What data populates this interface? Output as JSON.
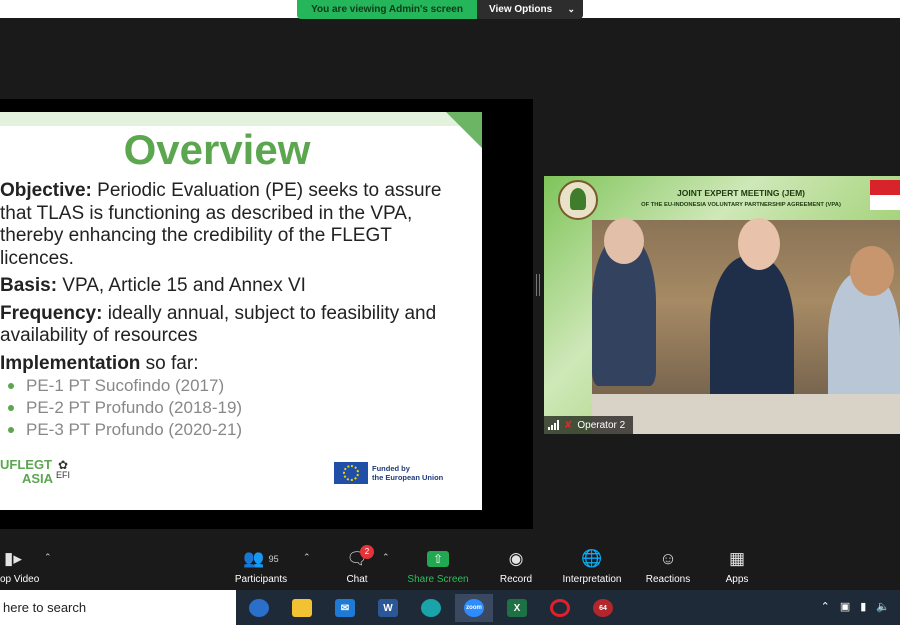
{
  "banner": {
    "viewing_text": "You are viewing Admin's screen",
    "view_options_label": "View Options"
  },
  "slide": {
    "title": "Overview",
    "objective_label": "Objective:",
    "objective_text": " Periodic Evaluation (PE) seeks to assure that TLAS  is functioning as described in the VPA, thereby enhancing the credibility of the FLEGT licences.",
    "basis_label": "Basis:",
    "basis_text": " VPA, Article 15 and Annex VI",
    "frequency_label": "Frequency:",
    "frequency_text": " ideally annual, subject to feasibility and availability of resources",
    "implementation_label": "Implementation",
    "implementation_text": " so far:",
    "bullets": [
      "PE-1 PT Sucofindo (2017)",
      "PE-2 PT Profundo (2018-19)",
      "PE-3 PT Profundo (2020-21)"
    ],
    "logo_left_line1": "UFLEGT",
    "logo_left_line2": "ASIA",
    "efi_label": "EFI",
    "eu_line1": "Funded by",
    "eu_line2": "the European Union"
  },
  "video": {
    "jem_title": "JOINT EXPERT MEETING (JEM)",
    "jem_subtitle": "OF THE EU-INDONESIA VOLUNTARY PARTNERSHIP AGREEMENT (VPA)",
    "participant_name": "Operator 2"
  },
  "toolbar": {
    "video_label": "op Video",
    "participants_label": "Participants",
    "participants_count": "95",
    "chat_label": "Chat",
    "chat_badge": "2",
    "share_label": "Share Screen",
    "record_label": "Record",
    "interpretation_label": "Interpretation",
    "reactions_label": "Reactions",
    "apps_label": "Apps"
  },
  "taskbar": {
    "search_text": "here to search",
    "chrome_badge": "64"
  },
  "colors": {
    "slide_green": "#5ba64f",
    "share_green": "#2dbd5f",
    "badge_red": "#e5333a"
  }
}
